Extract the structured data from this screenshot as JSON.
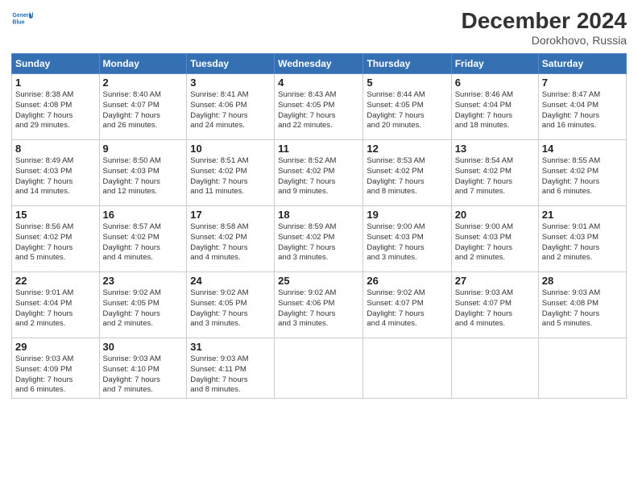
{
  "header": {
    "logo_line1": "General",
    "logo_line2": "Blue",
    "main_title": "December 2024",
    "subtitle": "Dorokhovo, Russia"
  },
  "days_of_week": [
    "Sunday",
    "Monday",
    "Tuesday",
    "Wednesday",
    "Thursday",
    "Friday",
    "Saturday"
  ],
  "weeks": [
    [
      {
        "day": 1,
        "lines": [
          "Sunrise: 8:38 AM",
          "Sunset: 4:08 PM",
          "Daylight: 7 hours",
          "and 29 minutes."
        ]
      },
      {
        "day": 2,
        "lines": [
          "Sunrise: 8:40 AM",
          "Sunset: 4:07 PM",
          "Daylight: 7 hours",
          "and 26 minutes."
        ]
      },
      {
        "day": 3,
        "lines": [
          "Sunrise: 8:41 AM",
          "Sunset: 4:06 PM",
          "Daylight: 7 hours",
          "and 24 minutes."
        ]
      },
      {
        "day": 4,
        "lines": [
          "Sunrise: 8:43 AM",
          "Sunset: 4:05 PM",
          "Daylight: 7 hours",
          "and 22 minutes."
        ]
      },
      {
        "day": 5,
        "lines": [
          "Sunrise: 8:44 AM",
          "Sunset: 4:05 PM",
          "Daylight: 7 hours",
          "and 20 minutes."
        ]
      },
      {
        "day": 6,
        "lines": [
          "Sunrise: 8:46 AM",
          "Sunset: 4:04 PM",
          "Daylight: 7 hours",
          "and 18 minutes."
        ]
      },
      {
        "day": 7,
        "lines": [
          "Sunrise: 8:47 AM",
          "Sunset: 4:04 PM",
          "Daylight: 7 hours",
          "and 16 minutes."
        ]
      }
    ],
    [
      {
        "day": 8,
        "lines": [
          "Sunrise: 8:49 AM",
          "Sunset: 4:03 PM",
          "Daylight: 7 hours",
          "and 14 minutes."
        ]
      },
      {
        "day": 9,
        "lines": [
          "Sunrise: 8:50 AM",
          "Sunset: 4:03 PM",
          "Daylight: 7 hours",
          "and 12 minutes."
        ]
      },
      {
        "day": 10,
        "lines": [
          "Sunrise: 8:51 AM",
          "Sunset: 4:02 PM",
          "Daylight: 7 hours",
          "and 11 minutes."
        ]
      },
      {
        "day": 11,
        "lines": [
          "Sunrise: 8:52 AM",
          "Sunset: 4:02 PM",
          "Daylight: 7 hours",
          "and 9 minutes."
        ]
      },
      {
        "day": 12,
        "lines": [
          "Sunrise: 8:53 AM",
          "Sunset: 4:02 PM",
          "Daylight: 7 hours",
          "and 8 minutes."
        ]
      },
      {
        "day": 13,
        "lines": [
          "Sunrise: 8:54 AM",
          "Sunset: 4:02 PM",
          "Daylight: 7 hours",
          "and 7 minutes."
        ]
      },
      {
        "day": 14,
        "lines": [
          "Sunrise: 8:55 AM",
          "Sunset: 4:02 PM",
          "Daylight: 7 hours",
          "and 6 minutes."
        ]
      }
    ],
    [
      {
        "day": 15,
        "lines": [
          "Sunrise: 8:56 AM",
          "Sunset: 4:02 PM",
          "Daylight: 7 hours",
          "and 5 minutes."
        ]
      },
      {
        "day": 16,
        "lines": [
          "Sunrise: 8:57 AM",
          "Sunset: 4:02 PM",
          "Daylight: 7 hours",
          "and 4 minutes."
        ]
      },
      {
        "day": 17,
        "lines": [
          "Sunrise: 8:58 AM",
          "Sunset: 4:02 PM",
          "Daylight: 7 hours",
          "and 4 minutes."
        ]
      },
      {
        "day": 18,
        "lines": [
          "Sunrise: 8:59 AM",
          "Sunset: 4:02 PM",
          "Daylight: 7 hours",
          "and 3 minutes."
        ]
      },
      {
        "day": 19,
        "lines": [
          "Sunrise: 9:00 AM",
          "Sunset: 4:03 PM",
          "Daylight: 7 hours",
          "and 3 minutes."
        ]
      },
      {
        "day": 20,
        "lines": [
          "Sunrise: 9:00 AM",
          "Sunset: 4:03 PM",
          "Daylight: 7 hours",
          "and 2 minutes."
        ]
      },
      {
        "day": 21,
        "lines": [
          "Sunrise: 9:01 AM",
          "Sunset: 4:03 PM",
          "Daylight: 7 hours",
          "and 2 minutes."
        ]
      }
    ],
    [
      {
        "day": 22,
        "lines": [
          "Sunrise: 9:01 AM",
          "Sunset: 4:04 PM",
          "Daylight: 7 hours",
          "and 2 minutes."
        ]
      },
      {
        "day": 23,
        "lines": [
          "Sunrise: 9:02 AM",
          "Sunset: 4:05 PM",
          "Daylight: 7 hours",
          "and 2 minutes."
        ]
      },
      {
        "day": 24,
        "lines": [
          "Sunrise: 9:02 AM",
          "Sunset: 4:05 PM",
          "Daylight: 7 hours",
          "and 3 minutes."
        ]
      },
      {
        "day": 25,
        "lines": [
          "Sunrise: 9:02 AM",
          "Sunset: 4:06 PM",
          "Daylight: 7 hours",
          "and 3 minutes."
        ]
      },
      {
        "day": 26,
        "lines": [
          "Sunrise: 9:02 AM",
          "Sunset: 4:07 PM",
          "Daylight: 7 hours",
          "and 4 minutes."
        ]
      },
      {
        "day": 27,
        "lines": [
          "Sunrise: 9:03 AM",
          "Sunset: 4:07 PM",
          "Daylight: 7 hours",
          "and 4 minutes."
        ]
      },
      {
        "day": 28,
        "lines": [
          "Sunrise: 9:03 AM",
          "Sunset: 4:08 PM",
          "Daylight: 7 hours",
          "and 5 minutes."
        ]
      }
    ],
    [
      {
        "day": 29,
        "lines": [
          "Sunrise: 9:03 AM",
          "Sunset: 4:09 PM",
          "Daylight: 7 hours",
          "and 6 minutes."
        ]
      },
      {
        "day": 30,
        "lines": [
          "Sunrise: 9:03 AM",
          "Sunset: 4:10 PM",
          "Daylight: 7 hours",
          "and 7 minutes."
        ]
      },
      {
        "day": 31,
        "lines": [
          "Sunrise: 9:03 AM",
          "Sunset: 4:11 PM",
          "Daylight: 7 hours",
          "and 8 minutes."
        ]
      },
      null,
      null,
      null,
      null
    ]
  ]
}
